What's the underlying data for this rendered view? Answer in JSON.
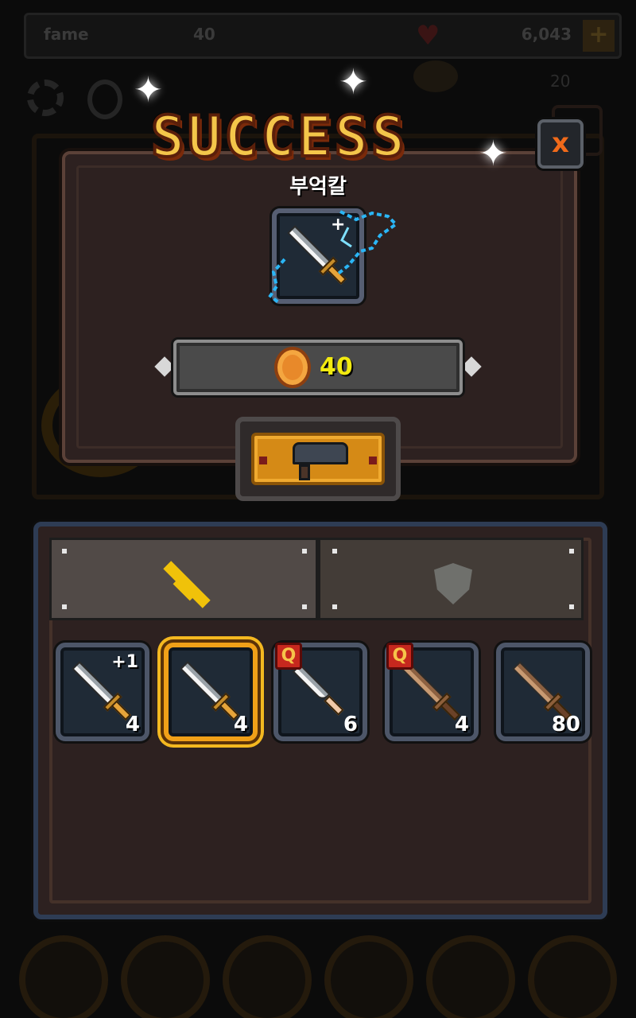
{
  "hud": {
    "fame_label": "fame",
    "fame_value": "40",
    "gold_value": "6,043",
    "plus_label": "+",
    "secondary_count": "20"
  },
  "dialog": {
    "title": "SUCCESS",
    "item_name": "부억칼",
    "item_upgrade_mark": "+",
    "cost_value": "40",
    "close_label": "x"
  },
  "inventory": {
    "tabs": [
      {
        "name": "weapon",
        "icon": "sword-icon",
        "active": true
      },
      {
        "name": "armor",
        "icon": "shield-icon",
        "active": false
      }
    ],
    "items": [
      {
        "icon": "kitchen-knife-icon",
        "level": "+1",
        "quantity": "4",
        "badge": "",
        "selected": false
      },
      {
        "icon": "kitchen-knife-icon",
        "level": "",
        "quantity": "4",
        "badge": "",
        "selected": true
      },
      {
        "icon": "dagger-icon",
        "level": "",
        "quantity": "6",
        "badge": "Q",
        "selected": false
      },
      {
        "icon": "wooden-sword-icon",
        "level": "",
        "quantity": "4",
        "badge": "Q",
        "selected": false
      },
      {
        "icon": "wooden-sword-icon",
        "level": "",
        "quantity": "80",
        "badge": "",
        "selected": false
      }
    ]
  },
  "colors": {
    "accent": "#f0a018",
    "title_fill": "#f4c64a",
    "cost_text": "#f2ea10",
    "panel_bg": "#2d2120"
  }
}
